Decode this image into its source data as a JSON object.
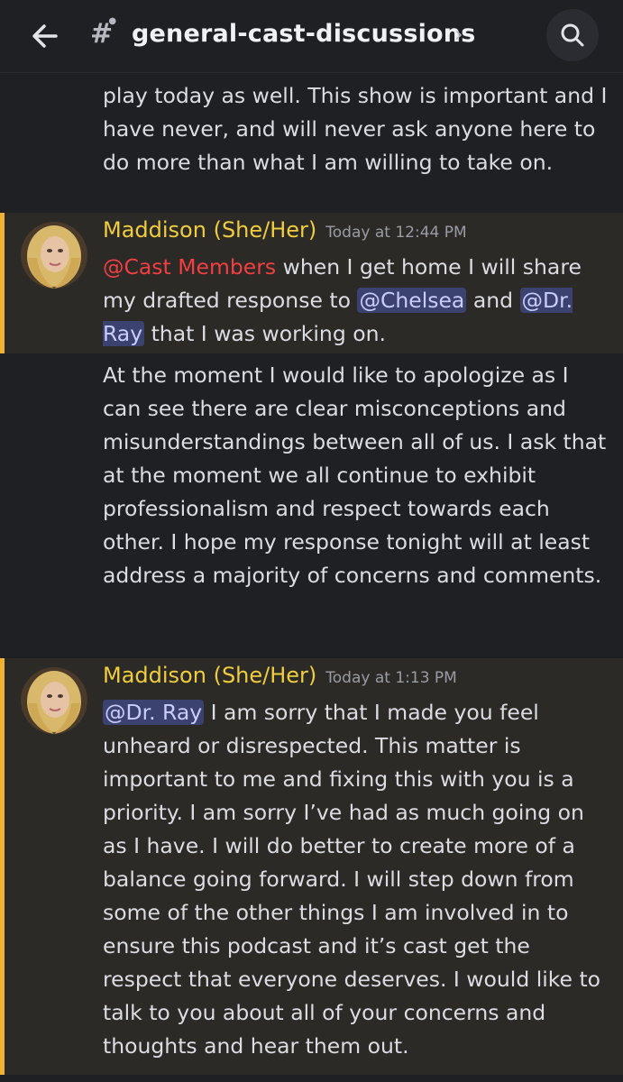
{
  "header": {
    "channel_name": "general-cast-discussions",
    "chevron": "›"
  },
  "icons": {
    "back": "back-arrow-icon",
    "channel": "hashtag-thread-icon",
    "search": "search-icon"
  },
  "colors": {
    "background": "#1f2024",
    "highlight_bg": "#2c2a27",
    "highlight_border": "#f0b232",
    "author": "#f0cd3d",
    "mention_bg": "#3c4270",
    "role_mention": "#f23f42"
  },
  "messages": {
    "top_continuation": "play today as well. This show is important and I have never, and will never ask anyone here to do more than what I am willing to take on.",
    "m1": {
      "author": "Maddison (She/Her)",
      "timestamp": "Today at 12:44 PM",
      "mention_role": "@Cast Members",
      "text_a": " when I get home I will share my drafted response to ",
      "mention_1": "@Chelsea",
      "text_b": " and ",
      "mention_2": "@Dr. Ray",
      "text_c": " that I was working on.",
      "continuation": "At the moment I would like to apologize as I can see there are clear misconceptions and misunderstandings between all of us. I ask that at the moment we all continue to exhibit professionalism and respect towards each other. I hope my response tonight will at least address a majority of concerns and comments."
    },
    "m2": {
      "author": "Maddison (She/Her)",
      "timestamp": "Today at 1:13 PM",
      "mention": "@Dr. Ray",
      "text": " I am sorry that I made you feel unheard or disrespected. This matter is important to me and fixing this with you is a priority. I am sorry I’ve had as much going on as I have. I will do better to create more of a balance going forward. I will step down from some of the other things I am involved in to ensure this podcast and it’s cast get the respect that everyone deserves. I would like to talk to you about all of your concerns and thoughts and hear them out."
    }
  }
}
